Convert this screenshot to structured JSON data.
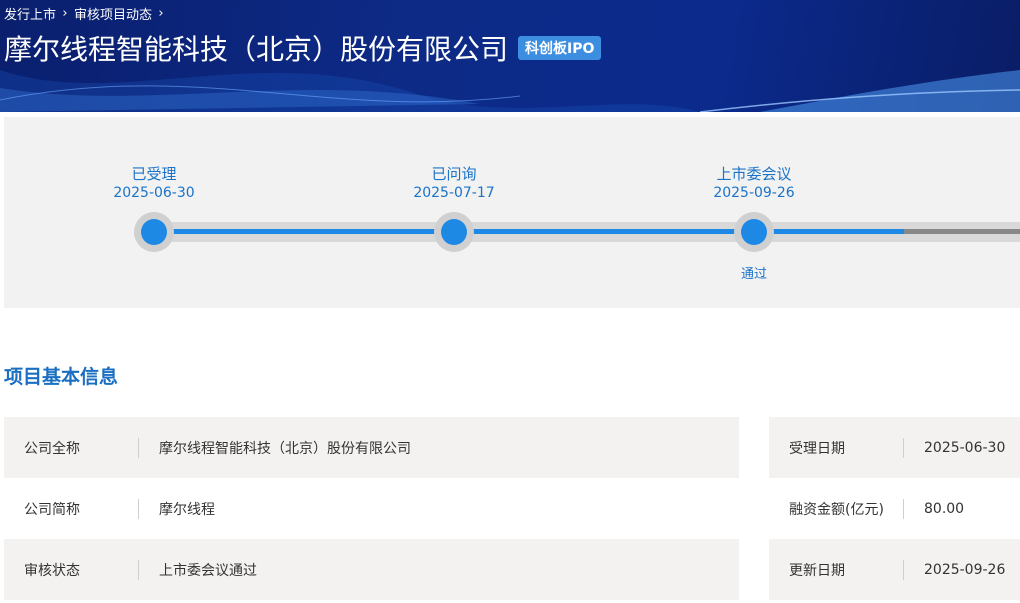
{
  "breadcrumb": [
    "发行上市",
    "审核项目动态"
  ],
  "title": "摩尔线程智能科技（北京）股份有限公司",
  "board_badge": "科创板IPO",
  "timeline": {
    "stages": [
      {
        "name": "已受理",
        "date": "2025-06-30",
        "result": ""
      },
      {
        "name": "已问询",
        "date": "2025-07-17",
        "result": ""
      },
      {
        "name": "上市委会议",
        "date": "2025-09-26",
        "result": "通过"
      }
    ],
    "colors": {
      "accent": "#1e88e5",
      "track": "#d9d9d9"
    }
  },
  "section_title": "项目基本信息",
  "info_left": [
    {
      "label": "公司全称",
      "value": "摩尔线程智能科技（北京）股份有限公司"
    },
    {
      "label": "公司简称",
      "value": "摩尔线程"
    },
    {
      "label": "审核状态",
      "value": "上市委会议通过"
    }
  ],
  "info_right": [
    {
      "label": "受理日期",
      "value": "2025-06-30"
    },
    {
      "label": "融资金额(亿元)",
      "value": "80.00"
    },
    {
      "label": "更新日期",
      "value": "2025-09-26"
    }
  ]
}
